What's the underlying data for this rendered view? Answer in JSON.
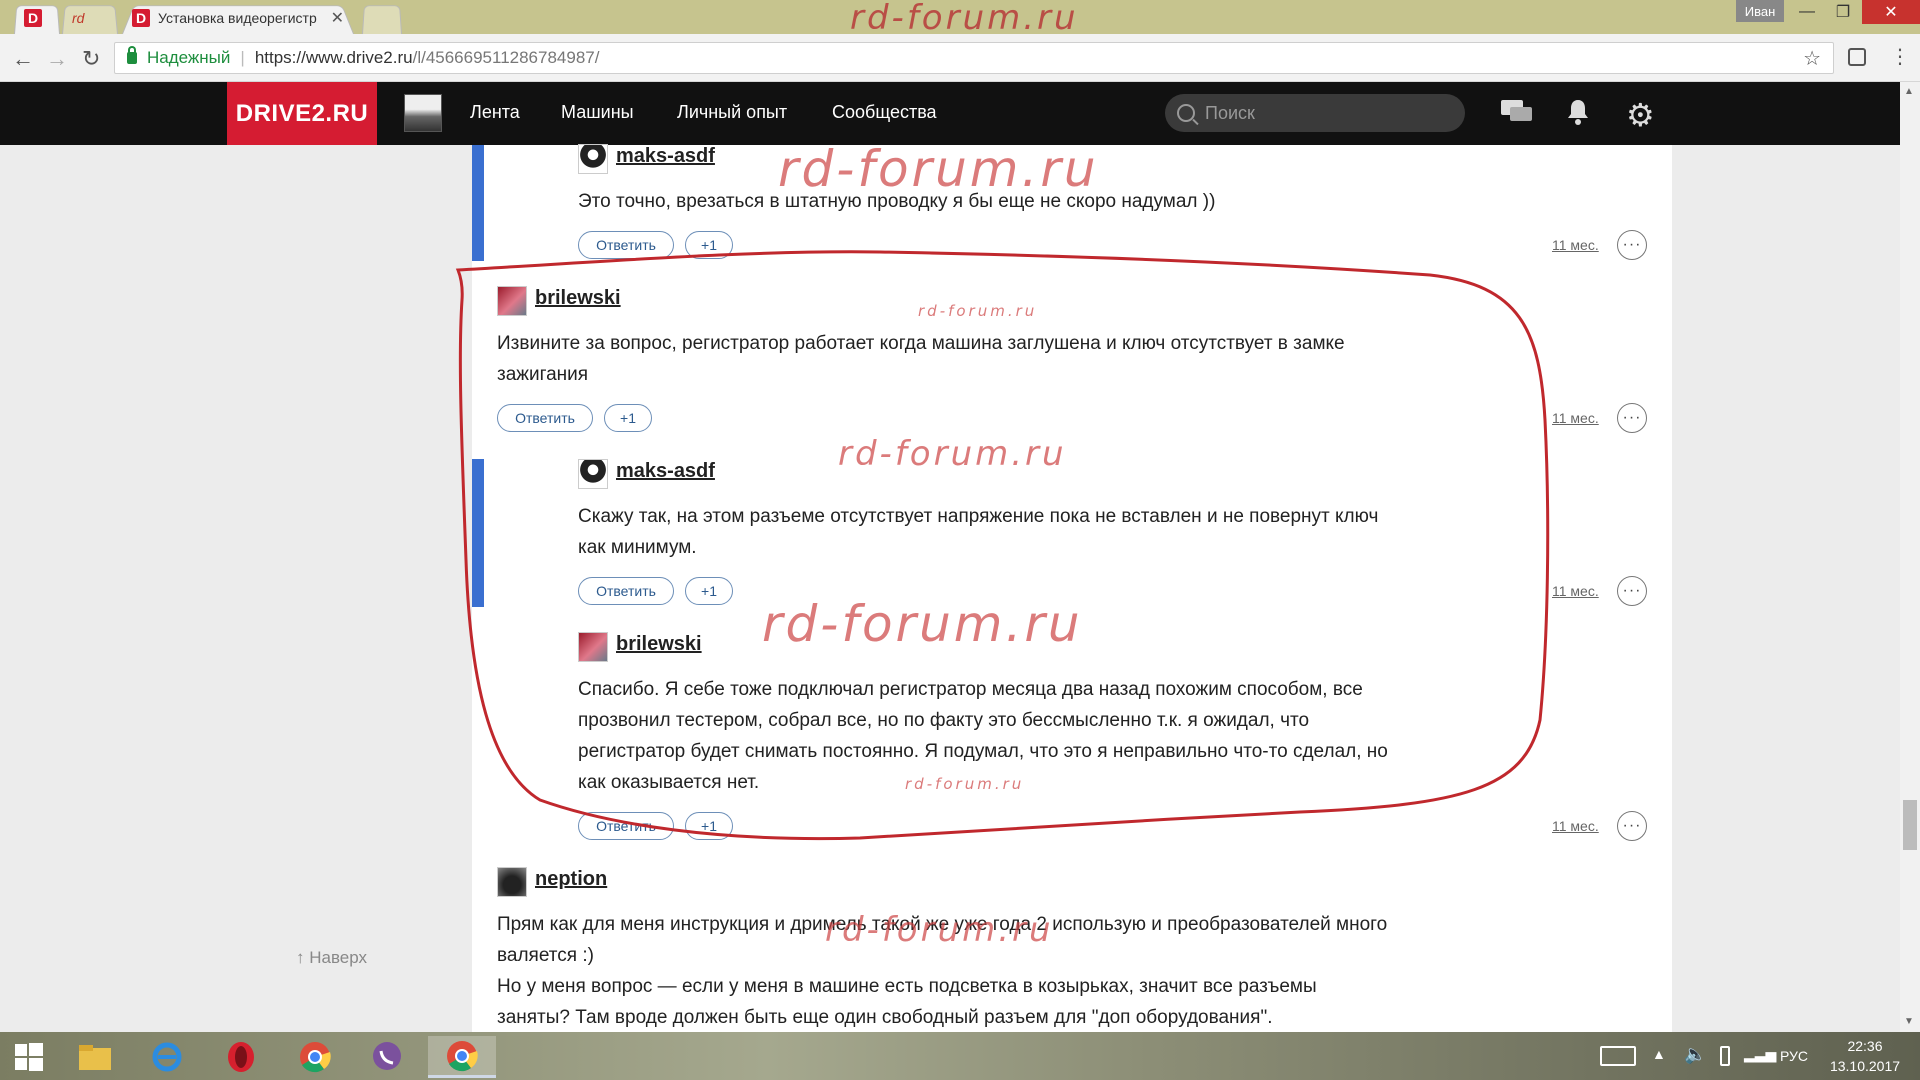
{
  "browser": {
    "tabs": [
      {
        "label": "D",
        "type": "pinned-drive2"
      },
      {
        "label": "rd",
        "type": "pinned-rd"
      },
      {
        "label": "Установка видеорегистр",
        "active": true
      }
    ],
    "watermark": "rd-forum.ru",
    "user": "Иван",
    "secure_label": "Надежный",
    "url_host": "https://www.drive2.ru",
    "url_path": "/l/456669511286784987/"
  },
  "site": {
    "logo": "DRIVE2.RU",
    "nav": [
      "Лента",
      "Машины",
      "Личный опыт",
      "Сообщества"
    ],
    "search_placeholder": "Поиск",
    "icons": [
      "messages-icon",
      "bell-icon",
      "gear-icon"
    ]
  },
  "comments": [
    {
      "author": "maks-asdf",
      "text": [
        "Это точно, врезаться в штатную проводку я бы еще не скоро надумал ))"
      ],
      "time": "11 мес.",
      "reply": "Ответить",
      "plus": "+1"
    },
    {
      "author": "brilewski",
      "text": [
        "Извините за вопрос, регистратор работает когда машина заглушена и ключ отсутствует в замке",
        "зажигания"
      ],
      "time": "11 мес.",
      "reply": "Ответить",
      "plus": "+1"
    },
    {
      "author": "maks-asdf",
      "text": [
        "Скажу так, на этом разъеме отсутствует напряжение пока не вставлен и не повернут ключ",
        "как минимум."
      ],
      "time": "11 мес.",
      "reply": "Ответить",
      "plus": "+1"
    },
    {
      "author": "brilewski",
      "text": [
        "Спасибо. Я себе тоже подключал регистратор месяца два назад похожим способом, все",
        "прозвонил тестером, собрал все, но по факту это бессмысленно т.к. я ожидал, что",
        "регистратор будет снимать постоянно. Я подумал, что это я неправильно что-то сделал, но",
        "как оказывается нет."
      ],
      "time": "11 мес.",
      "reply": "Ответить",
      "plus": "+1"
    },
    {
      "author": "neption",
      "text": [
        "Прям как для меня инструкция и дримель такой же уже года 2 использую и преобразователей много",
        "валяется :)",
        "Но у меня вопрос — если у меня в машине есть подсветка в козырьках, значит все разъемы",
        "заняты? Там вроде должен быть еще один свободный разъем для \"доп оборудования\"."
      ]
    }
  ],
  "watermarks": [
    "rd-forum.ru",
    "rd-forum.ru",
    "rd-forum.ru",
    "rd-forum.ru",
    "rd-forum.ru",
    "rd-forum.ru"
  ],
  "back_to_top": "Наверх",
  "taskbar": {
    "language": "РУС",
    "time": "22:36",
    "date": "13.10.2017",
    "apps": [
      "windows-start-icon",
      "file-explorer-icon",
      "internet-explorer-icon",
      "opera-icon",
      "chrome-icon",
      "viber-icon",
      "chrome-active-icon"
    ]
  },
  "colors": {
    "brand": "#d51c32",
    "thread": "#3a6fd0",
    "annotation": "#c0282d"
  }
}
